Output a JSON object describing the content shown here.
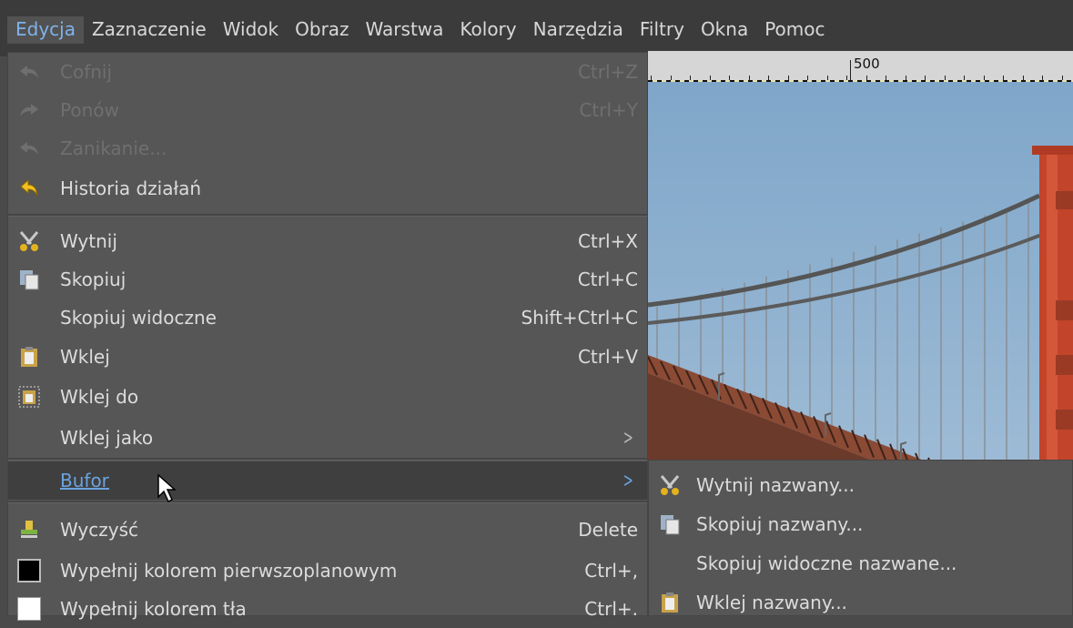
{
  "menubar": {
    "items": [
      "Edycja",
      "Zaznaczenie",
      "Widok",
      "Obraz",
      "Warstwa",
      "Kolory",
      "Narzędzia",
      "Filtry",
      "Okna",
      "Pomoc"
    ],
    "active": "Edycja"
  },
  "ruler": {
    "label": "500"
  },
  "edit_menu": {
    "undo": {
      "label": "Cofnij",
      "shortcut": "Ctrl+Z"
    },
    "redo": {
      "label": "Ponów",
      "shortcut": "Ctrl+Y"
    },
    "fade": {
      "label": "Zanikanie..."
    },
    "history": {
      "label": "Historia działań"
    },
    "cut": {
      "label": "Wytnij",
      "shortcut": "Ctrl+X"
    },
    "copy": {
      "label": "Skopiuj",
      "shortcut": "Ctrl+C"
    },
    "copy_visible": {
      "label": "Skopiuj widoczne",
      "shortcut": "Shift+Ctrl+C"
    },
    "paste": {
      "label": "Wklej",
      "shortcut": "Ctrl+V"
    },
    "paste_into": {
      "label": "Wklej do"
    },
    "paste_as": {
      "label": "Wklej jako"
    },
    "buffer": {
      "label": "Bufor"
    },
    "clear": {
      "label": "Wyczyść",
      "shortcut": "Delete"
    },
    "fill_fg": {
      "label": "Wypełnij kolorem pierwszoplanowym",
      "shortcut": "Ctrl+,"
    },
    "fill_bg": {
      "label": "Wypełnij kolorem tła",
      "shortcut": "Ctrl+."
    }
  },
  "buffer_menu": {
    "cut_named": "Wytnij nazwany...",
    "copy_named": "Skopiuj nazwany...",
    "copy_visible_named": "Skopiuj widoczne nazwane...",
    "paste_named": "Wklej nazwany..."
  },
  "colors": {
    "fg_swatch": "#000000",
    "bg_swatch": "#ffffff",
    "highlight_text": "#6aa3de"
  }
}
